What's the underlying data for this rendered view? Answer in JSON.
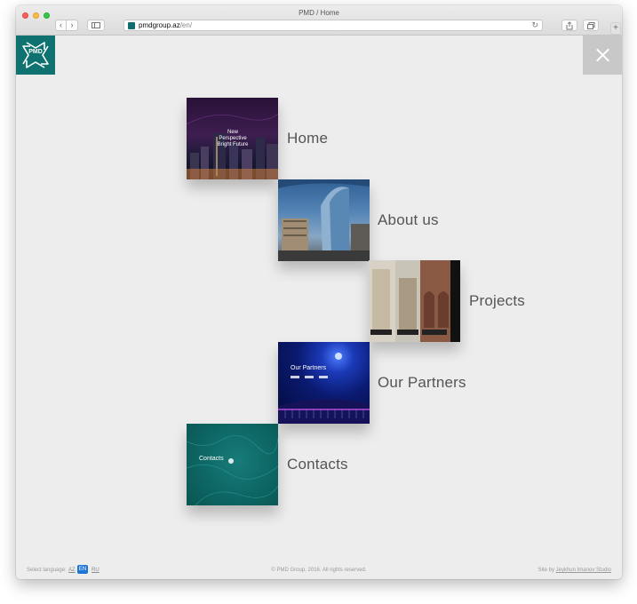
{
  "window": {
    "title": "PMD / Home"
  },
  "toolbar": {
    "back_icon": "chevron-left-icon",
    "forward_icon": "chevron-right-icon",
    "sidebar_icon": "sidebar-icon",
    "share_icon": "share-icon",
    "tabs_icon": "tabs-icon",
    "new_tab_label": "+"
  },
  "address": {
    "domain": "pmdgroup.az",
    "path": "/en/"
  },
  "header": {
    "logo_text": "PMD",
    "close_icon": "close-icon"
  },
  "colors": {
    "brand": "#107270",
    "accent_lang": "#1e77d6",
    "page_bg": "#ededed",
    "close_bg": "#c8c8c8"
  },
  "menu": {
    "items": [
      {
        "label": "Home",
        "caption": "New Perspective Bright Future"
      },
      {
        "label": "About us"
      },
      {
        "label": "Projects"
      },
      {
        "label": "Our Partners",
        "caption": "Our Partners"
      },
      {
        "label": "Contacts",
        "caption": "Contacts"
      }
    ]
  },
  "footer": {
    "language_label": "Select language:",
    "languages": [
      "AZ",
      "EN",
      "RU"
    ],
    "active_language": "EN",
    "copyright": "© PMD Group, 2016. All rights reserved.",
    "credit_prefix": "Site by",
    "credit_studio": "Jeykhun Imanov Studio"
  }
}
